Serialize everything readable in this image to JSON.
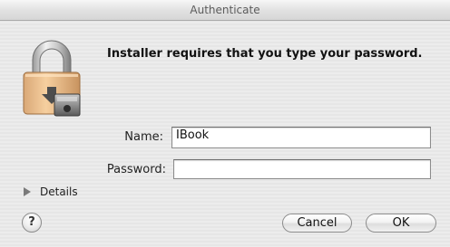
{
  "window": {
    "title": "Authenticate"
  },
  "icon": {
    "name": "lock-installer-icon"
  },
  "message": "Installer requires that you type your password.",
  "form": {
    "name_label": "Name:",
    "name_value": "IBook",
    "password_label": "Password:",
    "password_value": ""
  },
  "details": {
    "label": "Details",
    "expanded": false
  },
  "buttons": {
    "help_label": "?",
    "cancel_label": "Cancel",
    "ok_label": "OK"
  }
}
